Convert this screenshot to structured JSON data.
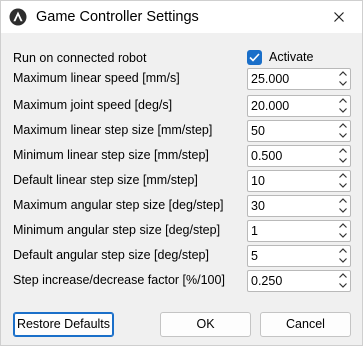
{
  "window": {
    "title": "Game Controller Settings"
  },
  "icons": {
    "app": "robot-logo-icon",
    "close": "close-icon",
    "spin_up": "chevron-up-icon",
    "spin_down": "chevron-down-icon",
    "check": "check-icon"
  },
  "colors": {
    "accent": "#1a6fc9",
    "background": "#f0f0f0",
    "field": "#ffffff"
  },
  "settings": {
    "run_on_connected_robot": {
      "label": "Run on connected robot",
      "checkbox_label": "Activate",
      "checked": true
    },
    "rows": [
      {
        "label": "Maximum linear speed [mm/s]",
        "value": "25.000"
      },
      {
        "label": "Maximum joint speed [deg/s]",
        "value": "20.000"
      },
      {
        "label": "Maximum linear step size [mm/step]",
        "value": "50"
      },
      {
        "label": "Minimum linear step size [mm/step]",
        "value": "0.500"
      },
      {
        "label": "Default linear step size [mm/step]",
        "value": "10"
      },
      {
        "label": "Maximum angular step size [deg/step]",
        "value": "30"
      },
      {
        "label": "Minimum angular step size [deg/step]",
        "value": "1"
      },
      {
        "label": "Default angular step size [deg/step]",
        "value": "5"
      },
      {
        "label": "Step increase/decrease factor [%/100]",
        "value": "0.250"
      }
    ]
  },
  "buttons": {
    "restore": "Restore Defaults",
    "ok": "OK",
    "cancel": "Cancel"
  }
}
